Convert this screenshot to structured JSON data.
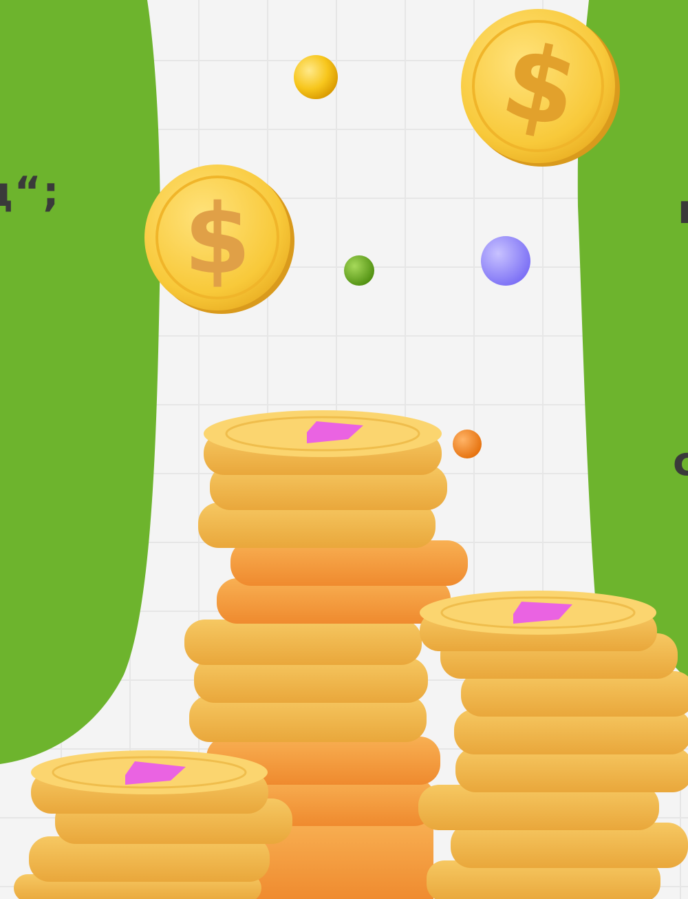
{
  "text_fragments": {
    "left": "ц“;",
    "right_top": "r",
    "right_middle": "c"
  },
  "colors": {
    "brand_green": "#6db42d",
    "background": "#f4f4f4",
    "grid_line": "#e6e6e6",
    "coin_gold": "#f8c93a",
    "coin_orange": "#f29a3c",
    "coin_symbol": "#e2a12c",
    "arrow_pink": "#ea63e2"
  },
  "icons": {
    "floating_coin": "dollar-coin-icon",
    "coin_mark": "pink-arrow-icon"
  },
  "coin_symbol": "$"
}
